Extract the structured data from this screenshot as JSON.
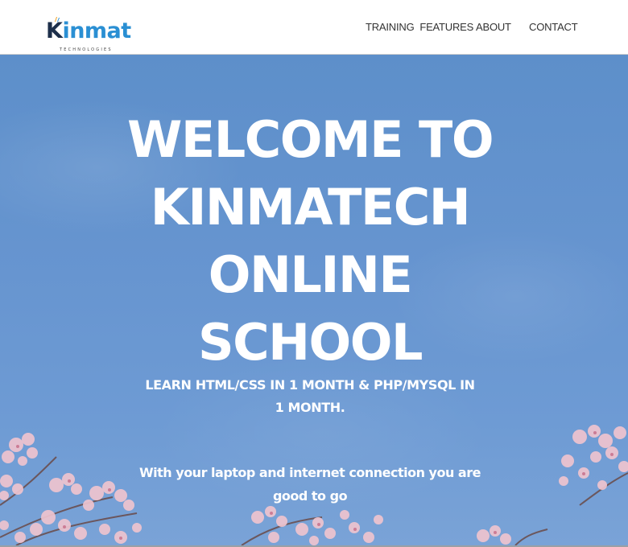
{
  "header": {
    "logo_main_initial": "K",
    "logo_main_rest": "inmat",
    "logo_sub": "TECHNOLOGIES",
    "nav": [
      {
        "label": "TRAINING  FEATURES"
      },
      {
        "label": "ABOUT"
      },
      {
        "label": "CONTACT"
      }
    ]
  },
  "hero": {
    "title_lines": [
      "WELCOME TO",
      "KINMATECH",
      "ONLINE",
      "SCHOOL"
    ],
    "subtitle": "LEARN HTML/CSS IN 1 MONTH & PHP/MYSQL IN 1 MONTH.",
    "description": "With your laptop and internet connection you are good to go"
  },
  "colors": {
    "sky": "#6795d0",
    "brand_blue": "#2a8fd3",
    "brand_dark": "#1d2f4a",
    "blossom_pink": "#eec6d0"
  }
}
